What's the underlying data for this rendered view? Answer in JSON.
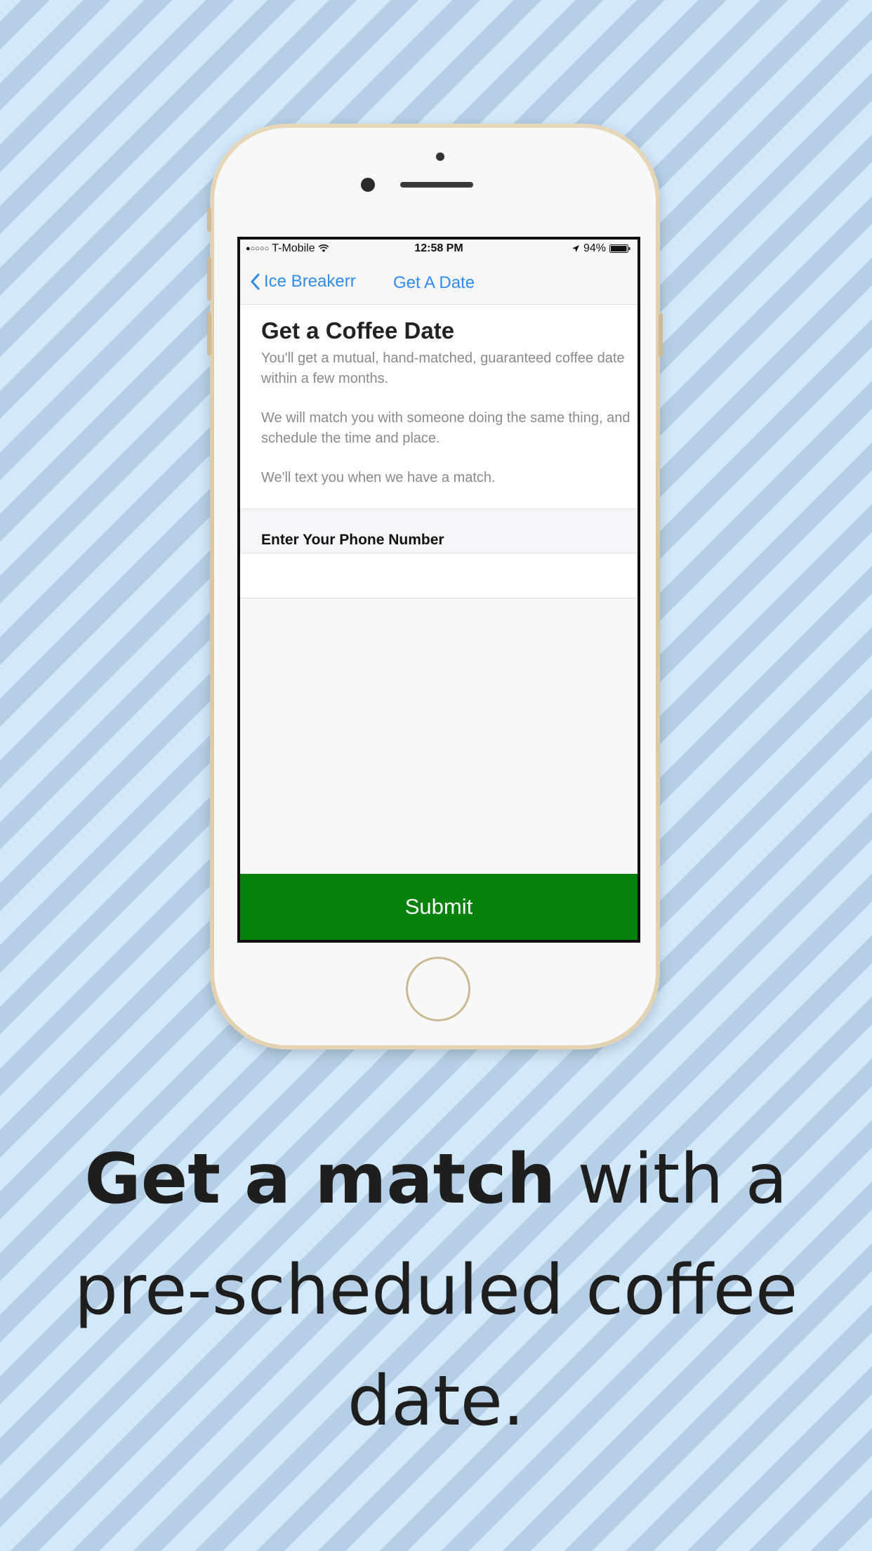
{
  "status_bar": {
    "signal": "●○○○○",
    "carrier": "T-Mobile",
    "time": "12:58 PM",
    "location_icon": "location-arrow-icon",
    "battery_percent": "94%",
    "battery_level": 0.94
  },
  "nav": {
    "back_label": "Ice Breakerr",
    "back_icon": "chevron-left-icon",
    "title": "Get A Date"
  },
  "content": {
    "title": "Get a Coffee Date",
    "paragraph_1": "You'll get a mutual, hand-matched, guaranteed coffee date within a few months.",
    "paragraph_2": "We will match you with someone doing the same thing, and schedule the time and place.",
    "paragraph_3": "We'll text you when we have a match."
  },
  "form": {
    "phone_label": "Enter Your Phone Number",
    "phone_value": "",
    "submit_label": "Submit"
  },
  "caption": {
    "bold_part": "Get a match",
    "regular_part": " with a pre-scheduled coffee date."
  },
  "colors": {
    "accent_blue": "#2f8cf0",
    "submit_green": "#06810a",
    "stripe_light": "#d2e8fb",
    "stripe_dark": "#b5cfe6",
    "phone_gold": "#e0cfae"
  }
}
